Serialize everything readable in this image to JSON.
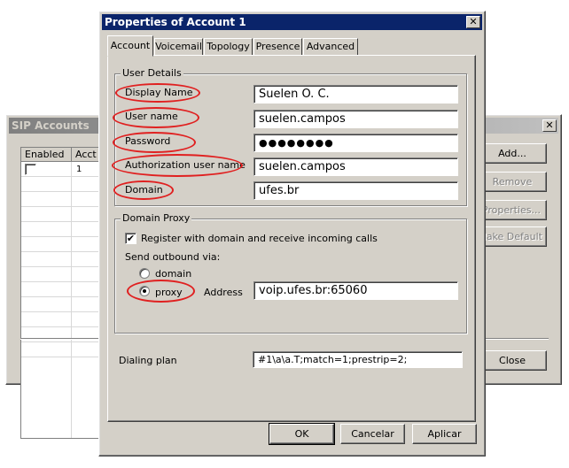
{
  "sip_accounts": {
    "title": "SIP Accounts",
    "columns": [
      "Enabled",
      "Acct #"
    ],
    "rows": [
      {
        "acct": "1"
      }
    ],
    "buttons": {
      "add": "Add...",
      "remove": "Remove",
      "properties": "Properties...",
      "make_default": "Make Default",
      "close": "Close"
    }
  },
  "dialog": {
    "title": "Properties of Account 1",
    "tabs": [
      "Account",
      "Voicemail",
      "Topology",
      "Presence",
      "Advanced"
    ],
    "user_details": {
      "group_title": "User Details",
      "display_name_label": "Display Name",
      "display_name": "Suelen O. C.",
      "user_name_label": "User name",
      "user_name": "suelen.campos",
      "password_label": "Password",
      "password": "●●●●●●●●",
      "auth_user_label": "Authorization user name",
      "auth_user": "suelen.campos",
      "domain_label": "Domain",
      "domain": "ufes.br"
    },
    "domain_proxy": {
      "group_title": "Domain Proxy",
      "register_label": "Register with domain and receive incoming calls",
      "register_check": "✔",
      "send_outbound_label": "Send outbound via:",
      "opt_domain": "domain",
      "opt_proxy": "proxy",
      "address_label": "Address",
      "address": "voip.ufes.br:65060"
    },
    "dialing_plan_label": "Dialing plan",
    "dialing_plan": "#1\\a\\a.T;match=1;prestrip=2;",
    "buttons": {
      "ok": "OK",
      "cancel": "Cancelar",
      "apply": "Aplicar"
    },
    "close_glyph": "✕"
  },
  "colors": {
    "titlebar_active": "#0a246a",
    "annotation": "#e02020",
    "face": "#d4d0c8"
  }
}
